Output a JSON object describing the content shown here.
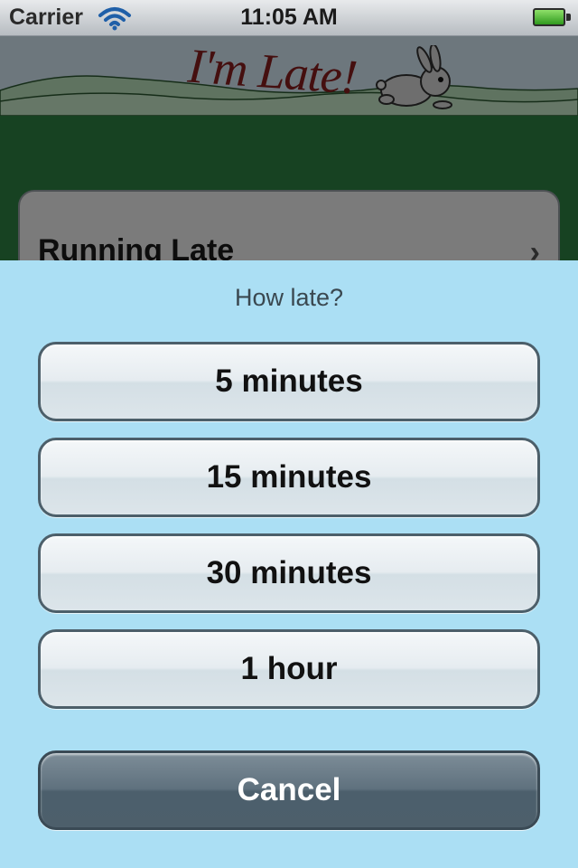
{
  "status_bar": {
    "carrier": "Carrier",
    "time": "11:05 AM"
  },
  "header": {
    "logo_text": "I'm Late!"
  },
  "background_cell": {
    "label": "Running Late",
    "chevron": "›"
  },
  "action_sheet": {
    "title": "How late?",
    "options": [
      "5 minutes",
      "15 minutes",
      "30 minutes",
      "1 hour"
    ],
    "cancel": "Cancel"
  },
  "icons": {
    "wifi": "wifi-icon",
    "battery": "battery-icon",
    "rabbit": "rabbit-icon",
    "chevron": "chevron-right-icon"
  },
  "colors": {
    "overlay_sheet": "#abdff4",
    "green": "#2e8444",
    "logo_red": "#8a1e1e"
  }
}
